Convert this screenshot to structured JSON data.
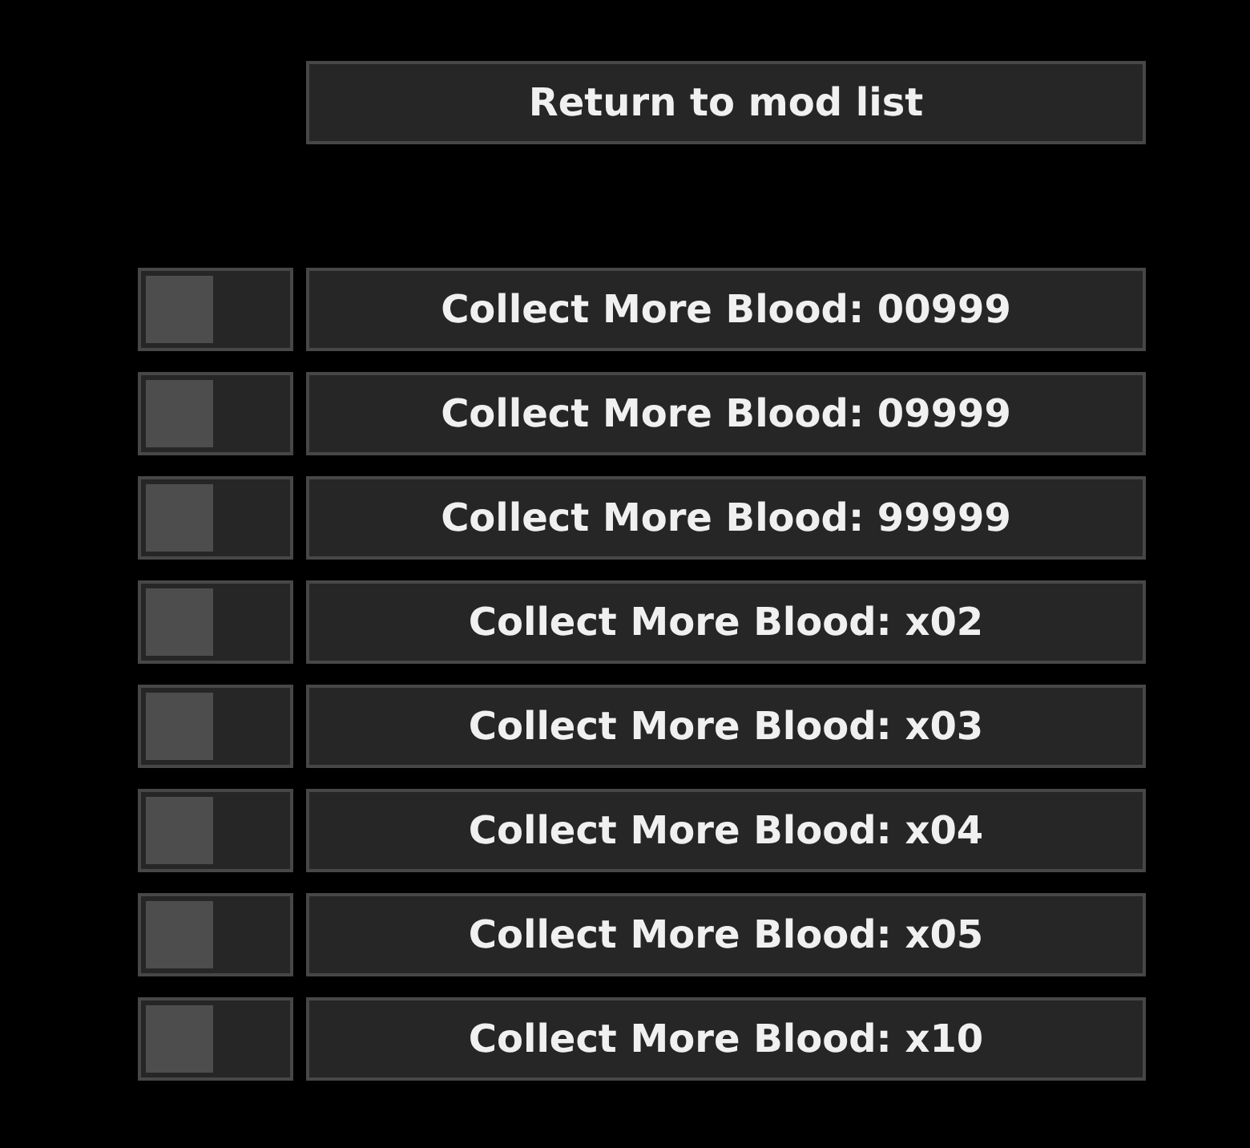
{
  "return_button": {
    "label": "Return to mod list"
  },
  "mods": [
    {
      "label": "Collect More Blood: 00999",
      "on": false
    },
    {
      "label": "Collect More Blood: 09999",
      "on": false
    },
    {
      "label": "Collect More Blood: 99999",
      "on": false
    },
    {
      "label": "Collect More Blood: x02",
      "on": false
    },
    {
      "label": "Collect More Blood: x03",
      "on": false
    },
    {
      "label": "Collect More Blood: x04",
      "on": false
    },
    {
      "label": "Collect More Blood: x05",
      "on": false
    },
    {
      "label": "Collect More Blood: x10",
      "on": false
    }
  ]
}
